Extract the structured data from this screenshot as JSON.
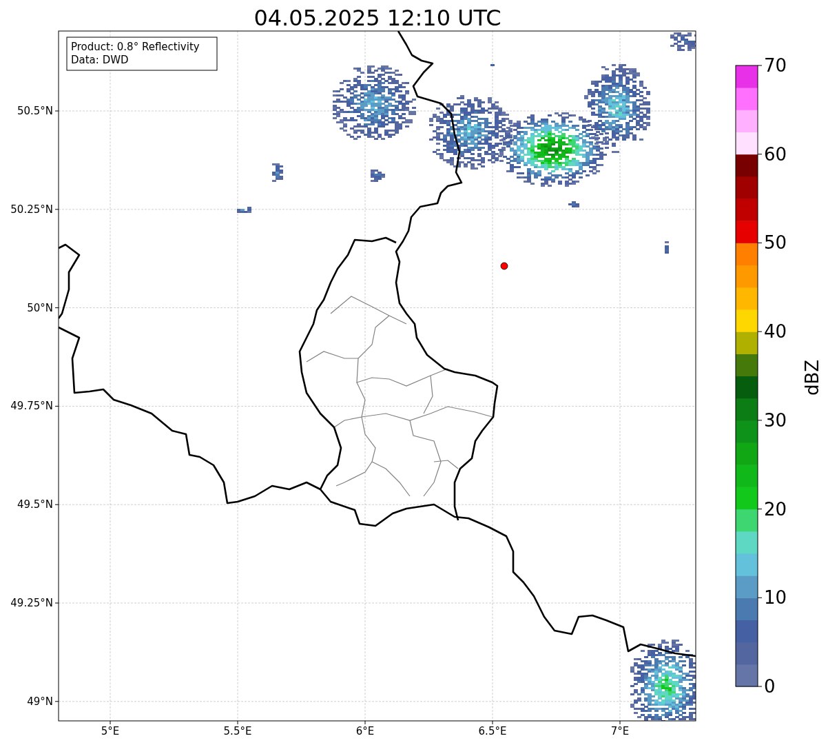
{
  "title": "04.05.2025 12:10 UTC",
  "info_box": {
    "lines": [
      "Product: 0.8° Reflectivity",
      "Data: DWD"
    ]
  },
  "map": {
    "x_ticks": [
      "5°E",
      "5.5°E",
      "6°E",
      "6.5°E",
      "7°E"
    ],
    "y_ticks": [
      "50.5°N",
      "50.25°N",
      "50°N",
      "49.75°N",
      "49.5°N",
      "49.25°N",
      "49°N"
    ]
  },
  "colorbar": {
    "label": "dBZ",
    "ticks": [
      "70",
      "60",
      "50",
      "40",
      "30",
      "20",
      "10",
      "0"
    ],
    "bins": [
      {
        "color": "#6575a8"
      },
      {
        "color": "#5466a0"
      },
      {
        "color": "#4560a3"
      },
      {
        "color": "#4a7ab0"
      },
      {
        "color": "#5a9cc6"
      },
      {
        "color": "#63c1dc"
      },
      {
        "color": "#5fd8c3"
      },
      {
        "color": "#3dd670"
      },
      {
        "color": "#12c81a"
      },
      {
        "color": "#10b81a"
      },
      {
        "color": "#10a614"
      },
      {
        "color": "#0e921a"
      },
      {
        "color": "#0c7d14"
      },
      {
        "color": "#065d0e"
      },
      {
        "color": "#457a0a"
      },
      {
        "color": "#b0b000"
      },
      {
        "color": "#ffd700"
      },
      {
        "color": "#ffb700"
      },
      {
        "color": "#ff9900"
      },
      {
        "color": "#ff7f00"
      },
      {
        "color": "#e60000"
      },
      {
        "color": "#c00000"
      },
      {
        "color": "#a00000"
      },
      {
        "color": "#780000"
      },
      {
        "color": "#ffe0ff"
      },
      {
        "color": "#ffb0ff"
      },
      {
        "color": "#ff70ff"
      },
      {
        "color": "#e830e8"
      }
    ]
  }
}
